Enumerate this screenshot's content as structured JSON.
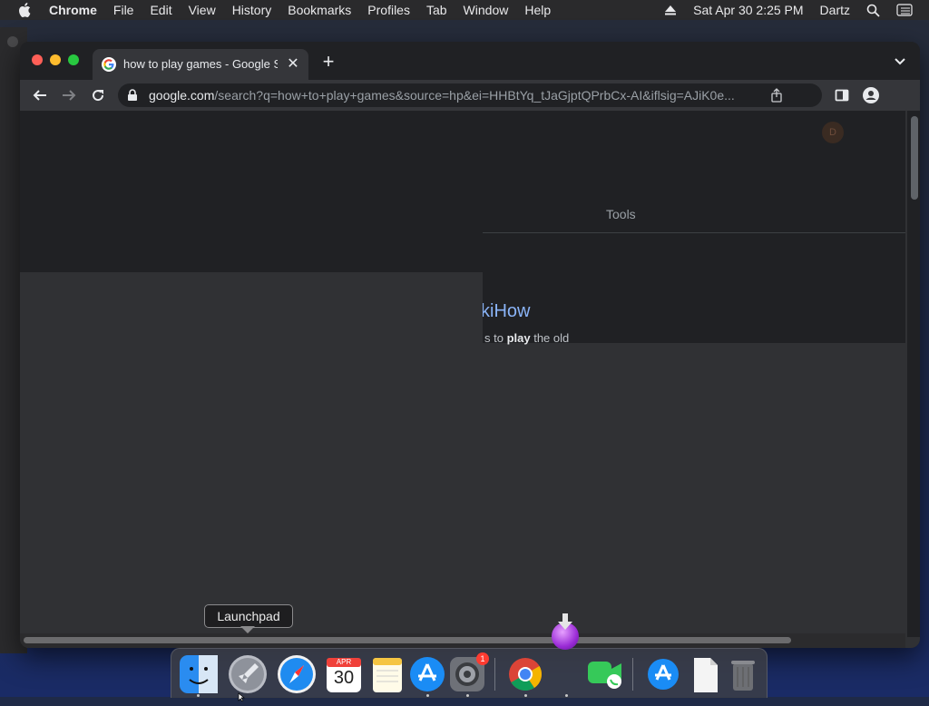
{
  "menubar": {
    "app_name": "Chrome",
    "items": [
      "File",
      "Edit",
      "View",
      "History",
      "Bookmarks",
      "Profiles",
      "Tab",
      "Window",
      "Help"
    ],
    "datetime": "Sat Apr 30  2:25 PM",
    "user": "Dartz"
  },
  "browser": {
    "tab_title": "how to play games - Google Se",
    "url_host": "google.com",
    "url_rest": "/search?q=how+to+play+games&source=hp&ei=HHBtYq_tJaGjptQPrbCx-AI&iflsig=AJiK0e..."
  },
  "page": {
    "tools_label": "Tools",
    "avatar_text": "D",
    "result_title": "kiHow",
    "snippet_pre": "s to ",
    "snippet_bold": "play",
    "snippet_post": " the old"
  },
  "dock": {
    "tooltip": "Launchpad",
    "calendar_month": "APR",
    "calendar_day": "30",
    "settings_badge": "1"
  },
  "colors": {
    "link": "#8ab4f8",
    "page_bg": "#202124",
    "toolbar_bg": "#35363a"
  }
}
